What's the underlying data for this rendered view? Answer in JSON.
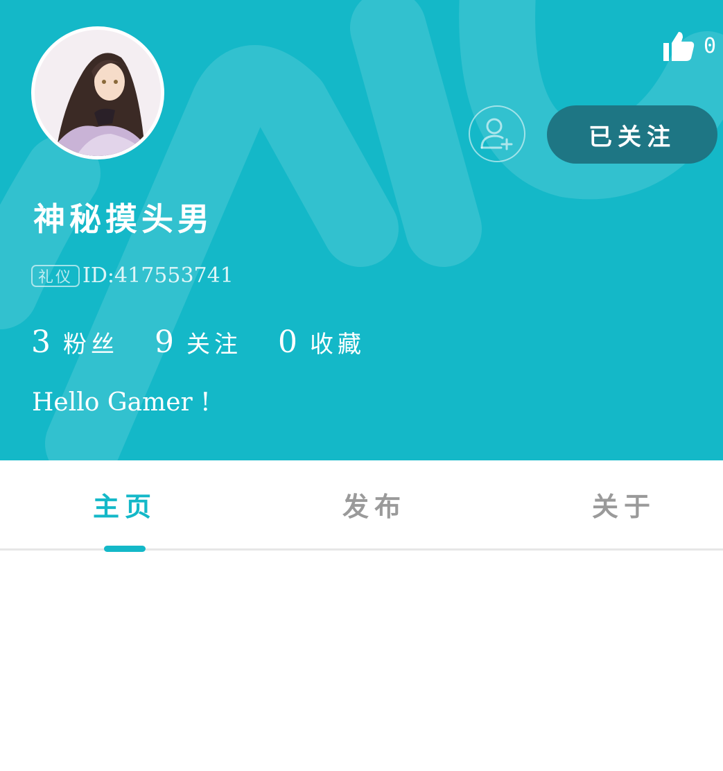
{
  "colors": {
    "accent": "#14b8c8",
    "follow_button": "#1e7684",
    "tab_inactive": "#9a9a9a"
  },
  "header": {
    "like_icon": "thumbs-up-icon",
    "like_count": "0",
    "add_friend_icon": "add-user-icon",
    "follow_label": "已关注"
  },
  "profile": {
    "name": "神秘摸头男",
    "tag": "礼仪",
    "id_text": "ID:417553741",
    "stats": [
      {
        "value": "3",
        "label": "粉丝"
      },
      {
        "value": "9",
        "label": "关注"
      },
      {
        "value": "0",
        "label": "收藏"
      }
    ],
    "bio": "Hello Gamer !"
  },
  "tabs": [
    {
      "label": "主页",
      "active": true
    },
    {
      "label": "发布",
      "active": false
    },
    {
      "label": "关于",
      "active": false
    }
  ]
}
